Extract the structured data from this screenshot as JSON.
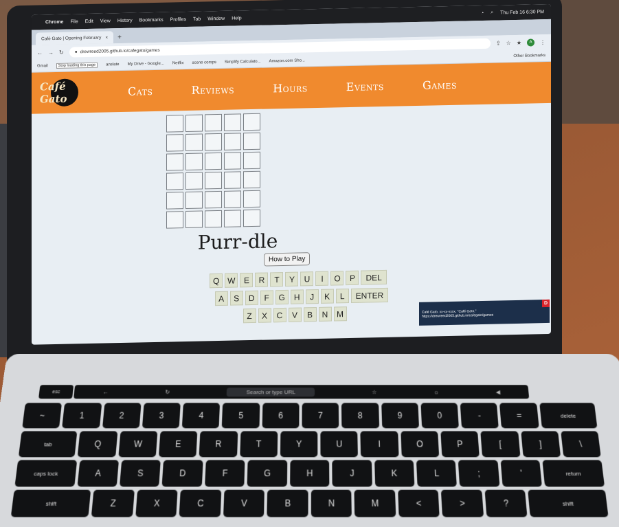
{
  "menubar": {
    "apple": "",
    "items": [
      "Chrome",
      "File",
      "Edit",
      "View",
      "History",
      "Bookmarks",
      "Profiles",
      "Tab",
      "Window",
      "Help"
    ],
    "clock": "Thu Feb 16  6:30 PM"
  },
  "browser": {
    "tab_title": "Café Gato | Opening February",
    "tab_close": "×",
    "new_tab": "+",
    "url": "drewreed2005.github.io/cafegato/games",
    "bookmarks": [
      "Gmail",
      "My Drive - Google...",
      "Netflix",
      "scene comps",
      "Simplify Calculato...",
      "Amazon.com Sho..."
    ],
    "tooltip": "Stop loading this page",
    "translate": "anslate",
    "other_bookmarks": "Other Bookmarks"
  },
  "site": {
    "logo_text": "Café Gato",
    "nav": [
      "Cats",
      "Reviews",
      "Hours",
      "Events",
      "Games"
    ]
  },
  "game": {
    "title": "Purr-dle",
    "how_to_play": "How to Play",
    "rows": 6,
    "cols": 5,
    "keyboard": [
      [
        "Q",
        "W",
        "E",
        "R",
        "T",
        "Y",
        "U",
        "I",
        "O",
        "P",
        "DEL"
      ],
      [
        "A",
        "S",
        "D",
        "F",
        "G",
        "H",
        "J",
        "K",
        "L",
        "ENTER"
      ],
      [
        "Z",
        "X",
        "C",
        "V",
        "B",
        "N",
        "M"
      ]
    ]
  },
  "status_popup": {
    "line1": "Café Gato, xx-xx-xxxx, \"Café Gato,\"",
    "line2": "https://drewreed2005.github.io/cafegato/games",
    "close": "D"
  },
  "hardware_keyboard": {
    "esc": "esc",
    "touchbar_search": "Search or type URL",
    "rows": [
      [
        "~",
        "1",
        "2",
        "3",
        "4",
        "5",
        "6",
        "7",
        "8",
        "9",
        "0",
        "-",
        "=",
        "delete"
      ],
      [
        "tab",
        "Q",
        "W",
        "E",
        "R",
        "T",
        "Y",
        "U",
        "I",
        "O",
        "P",
        "[",
        "]",
        "\\"
      ],
      [
        "caps lock",
        "A",
        "S",
        "D",
        "F",
        "G",
        "H",
        "J",
        "K",
        "L",
        ";",
        "'",
        "return"
      ],
      [
        "shift",
        "Z",
        "X",
        "C",
        "V",
        "B",
        "N",
        "M",
        "<",
        ">",
        "?",
        "shift"
      ]
    ]
  }
}
